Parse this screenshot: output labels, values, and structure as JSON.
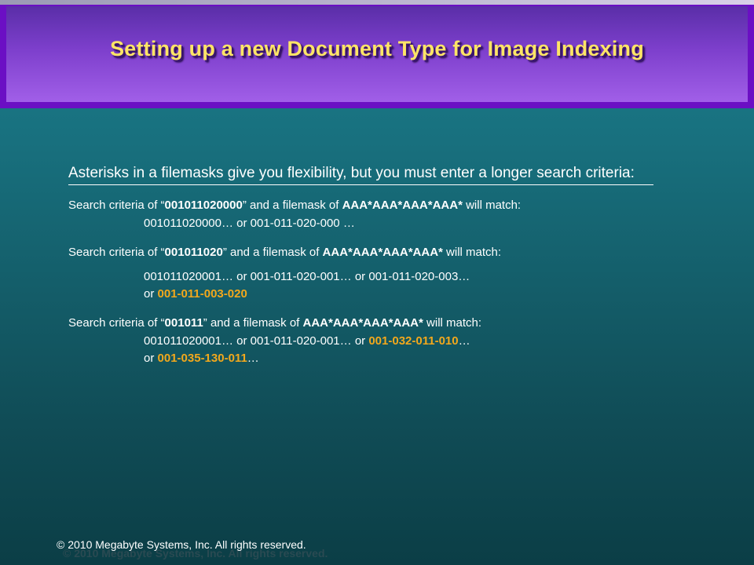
{
  "title": "Setting up a new Document Type for Image Indexing",
  "intro": "Asterisks in a filemasks give you flexibility, but you must enter a longer search criteria:",
  "block1": {
    "lead": "Search criteria of “",
    "criteria": "001011020000",
    "mid": "” and a filemask of ",
    "mask": "AAA*AAA*AAA*AAA*",
    "tail": " will match:",
    "line1": "001011020000… or 001-011-020-000 …"
  },
  "block2": {
    "lead": "Search criteria of “",
    "criteria": "001011020",
    "mid": "” and a filemask of ",
    "mask": "AAA*AAA*AAA*AAA*",
    "tail": " will match:",
    "line1": "001011020001… or 001-011-020-001… or 001-011-020-003…",
    "or": "or ",
    "hl1": "001-011-003-020"
  },
  "block3": {
    "lead": "Search criteria of “",
    "criteria": "001011",
    "mid": "” and a filemask of ",
    "mask": "AAA*AAA*AAA*AAA*",
    "tail": " will match:",
    "line1a": "001011020001… or 001-011-020-001… or ",
    "hl1": "001-032-011-010",
    "ell1": "…",
    "or": "or ",
    "hl2": "001-035-130-011",
    "ell2": "…"
  },
  "footer": "© 2010 Megabyte Systems, Inc. All rights reserved.",
  "colors": {
    "title": "#ffe566",
    "highlight": "#f2a81c",
    "banner": "#6b0fc4",
    "background": "#176b78"
  }
}
